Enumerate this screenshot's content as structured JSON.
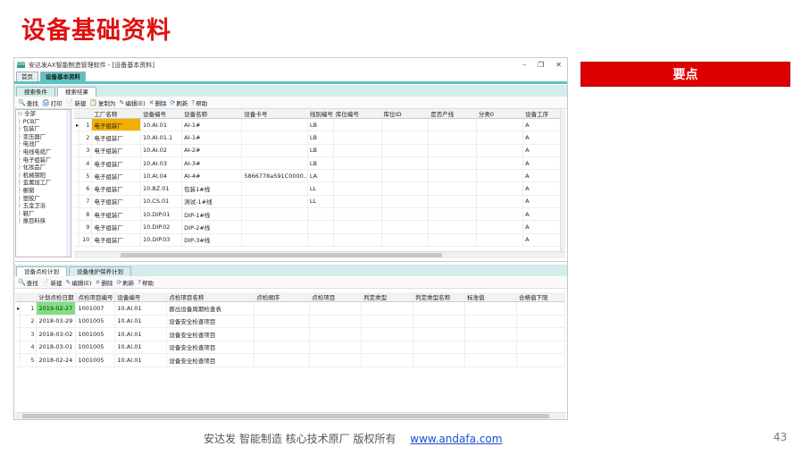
{
  "slide": {
    "title": "设备基础资料",
    "keypoint": "要点",
    "footer_text": "安达发   智能制造 核心技术原厂    版权所有",
    "footer_link": "www.andafa.com",
    "page_number": "43"
  },
  "window": {
    "app_icon": "ERP",
    "title": "安达发AX智能制造管理软件 - [设备基本资料]",
    "controls": {
      "minimize": "–",
      "restore": "❐",
      "close": "✕"
    },
    "doc_tabs": [
      "首页",
      "设备基本资料"
    ],
    "sub_tabs": [
      "搜索条件",
      "搜索结果"
    ]
  },
  "toolbar1": [
    {
      "icon": "🔍",
      "label": "查找"
    },
    {
      "icon": "🖨",
      "label": "打印"
    },
    {
      "icon": "📄",
      "label": "新建"
    },
    {
      "icon": "📋",
      "label": "复制为"
    },
    {
      "icon": "✎",
      "label": "编辑(E)"
    },
    {
      "icon": "✕",
      "label": "删除"
    },
    {
      "icon": "⟳",
      "label": "刷新"
    },
    {
      "icon": "?",
      "label": "帮助"
    }
  ],
  "tree": [
    "全部",
    "PCB厂",
    "包装厂",
    "变压器厂",
    "电池厂",
    "电线电缆厂",
    "电子组装厂",
    "化妆品厂",
    "机械钢阳",
    "金属加工厂",
    "橱窗",
    "塑胶厂",
    "五金卫浴",
    "鞋厂",
    "振目料挟"
  ],
  "grid1": {
    "headers": [
      "",
      "",
      "工厂名称",
      "设备编号",
      "设备名称",
      "设备卡号",
      "线别编号",
      "库位编号",
      "库位ID",
      "是否产线",
      "分类0",
      "设备工序"
    ],
    "rows": [
      [
        "▸",
        "1",
        "电子组装厂",
        "10.AI.01",
        "AI-1#",
        "",
        "LB",
        "",
        "",
        "",
        "",
        "A"
      ],
      [
        "",
        "2",
        "电子组装厂",
        "10.AI.01.1",
        "AI-1#",
        "",
        "LB",
        "",
        "",
        "",
        "",
        "A"
      ],
      [
        "",
        "3",
        "电子组装厂",
        "10.AI.02",
        "AI-2#",
        "",
        "LB",
        "",
        "",
        "",
        "",
        "A"
      ],
      [
        "",
        "4",
        "电子组装厂",
        "10.AI.03",
        "AI-3#",
        "",
        "LB",
        "",
        "",
        "",
        "",
        "A"
      ],
      [
        "",
        "5",
        "电子组装厂",
        "10.AI.04",
        "AI-4#",
        "5866778a591C0000..",
        "LA",
        "",
        "",
        "",
        "",
        "A"
      ],
      [
        "",
        "6",
        "电子组装厂",
        "10.BZ.01",
        "包装1#线",
        "",
        "LL",
        "",
        "",
        "",
        "",
        "A"
      ],
      [
        "",
        "7",
        "电子组装厂",
        "10.CS.01",
        "测试-1#线",
        "",
        "LL",
        "",
        "",
        "",
        "",
        "A"
      ],
      [
        "",
        "8",
        "电子组装厂",
        "10.DIP.01",
        "DIP-1#线",
        "",
        "",
        "",
        "",
        "",
        "",
        "A"
      ],
      [
        "",
        "9",
        "电子组装厂",
        "10.DIP.02",
        "DIP-2#线",
        "",
        "",
        "",
        "",
        "",
        "",
        "A"
      ],
      [
        "",
        "10",
        "电子组装厂",
        "10.DIP.03",
        "DIP-3#线",
        "",
        "",
        "",
        "",
        "",
        "",
        "A"
      ]
    ]
  },
  "lower_tabs": [
    "设备点检计划",
    "设备维护保养计划"
  ],
  "toolbar2": [
    {
      "icon": "🔍",
      "label": "查找"
    },
    {
      "icon": "📄",
      "label": "新建"
    },
    {
      "icon": "✎",
      "label": "编辑(E)"
    },
    {
      "icon": "✕",
      "label": "删除"
    },
    {
      "icon": "⟳",
      "label": "刷新"
    },
    {
      "icon": "?",
      "label": "帮助"
    }
  ],
  "grid2": {
    "headers": [
      "",
      "",
      "计划点检日期",
      "点检项目编号",
      "设备编号",
      "点检项目名称",
      "点检顺序",
      "点检项目",
      "判定类型",
      "判定类型名称",
      "标准值",
      "合格值下限"
    ],
    "rows": [
      [
        "▸",
        "1",
        "2019-02-27",
        "1001007",
        "10.AI.01",
        "撕出设备周期检查表",
        "",
        "",
        "",
        "",
        "",
        ""
      ],
      [
        "",
        "2",
        "2018-03-29",
        "1001005",
        "10.AI.01",
        "设备安全检查项目",
        "",
        "",
        "",
        "",
        "",
        ""
      ],
      [
        "",
        "3",
        "2018-03-02",
        "1001005",
        "10.AI.01",
        "设备安全检查项目",
        "",
        "",
        "",
        "",
        "",
        ""
      ],
      [
        "",
        "4",
        "2018-03-01",
        "1001005",
        "10.AI.01",
        "设备安全检查项目",
        "",
        "",
        "",
        "",
        "",
        ""
      ],
      [
        "",
        "5",
        "2018-02-24",
        "1001005",
        "10.AI.01",
        "设备安全检查项目",
        "",
        "",
        "",
        "",
        "",
        ""
      ]
    ]
  }
}
